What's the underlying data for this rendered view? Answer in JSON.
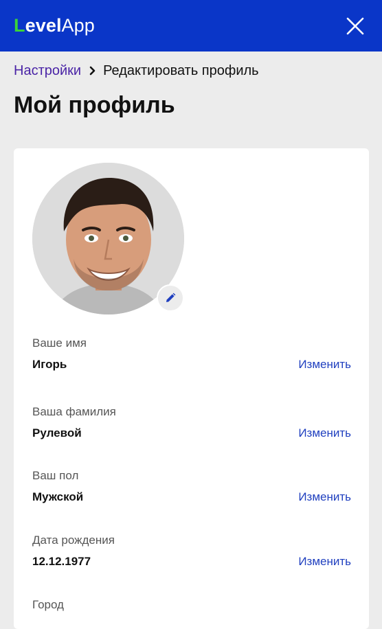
{
  "app": {
    "logo_first_letter": "L",
    "logo_rest": "evel",
    "logo_suffix": "App",
    "close_icon": "close-icon"
  },
  "breadcrumb": {
    "parent": "Настройки",
    "separator_icon": "chevron-right-icon",
    "current": "Редактировать профиль"
  },
  "page": {
    "title": "Мой профиль"
  },
  "profile": {
    "avatar_alt": "avatar",
    "edit_photo_icon": "pencil-icon",
    "fields": [
      {
        "label": "Ваше имя",
        "value": "Игорь",
        "action": "Изменить"
      },
      {
        "label": "Ваша фамилия",
        "value": "Рулевой",
        "action": "Изменить"
      },
      {
        "label": "Ваш пол",
        "value": "Мужской",
        "action": "Изменить"
      },
      {
        "label": "Дата рождения",
        "value": "12.12.1977",
        "action": "Изменить"
      },
      {
        "label": "Город",
        "value": "",
        "action": ""
      }
    ]
  },
  "colors": {
    "brand_blue": "#0a36c8",
    "logo_green": "#3ad43a",
    "link_purple": "#4a24a6",
    "action_blue": "#1f3fbf",
    "page_bg": "#ececec"
  }
}
